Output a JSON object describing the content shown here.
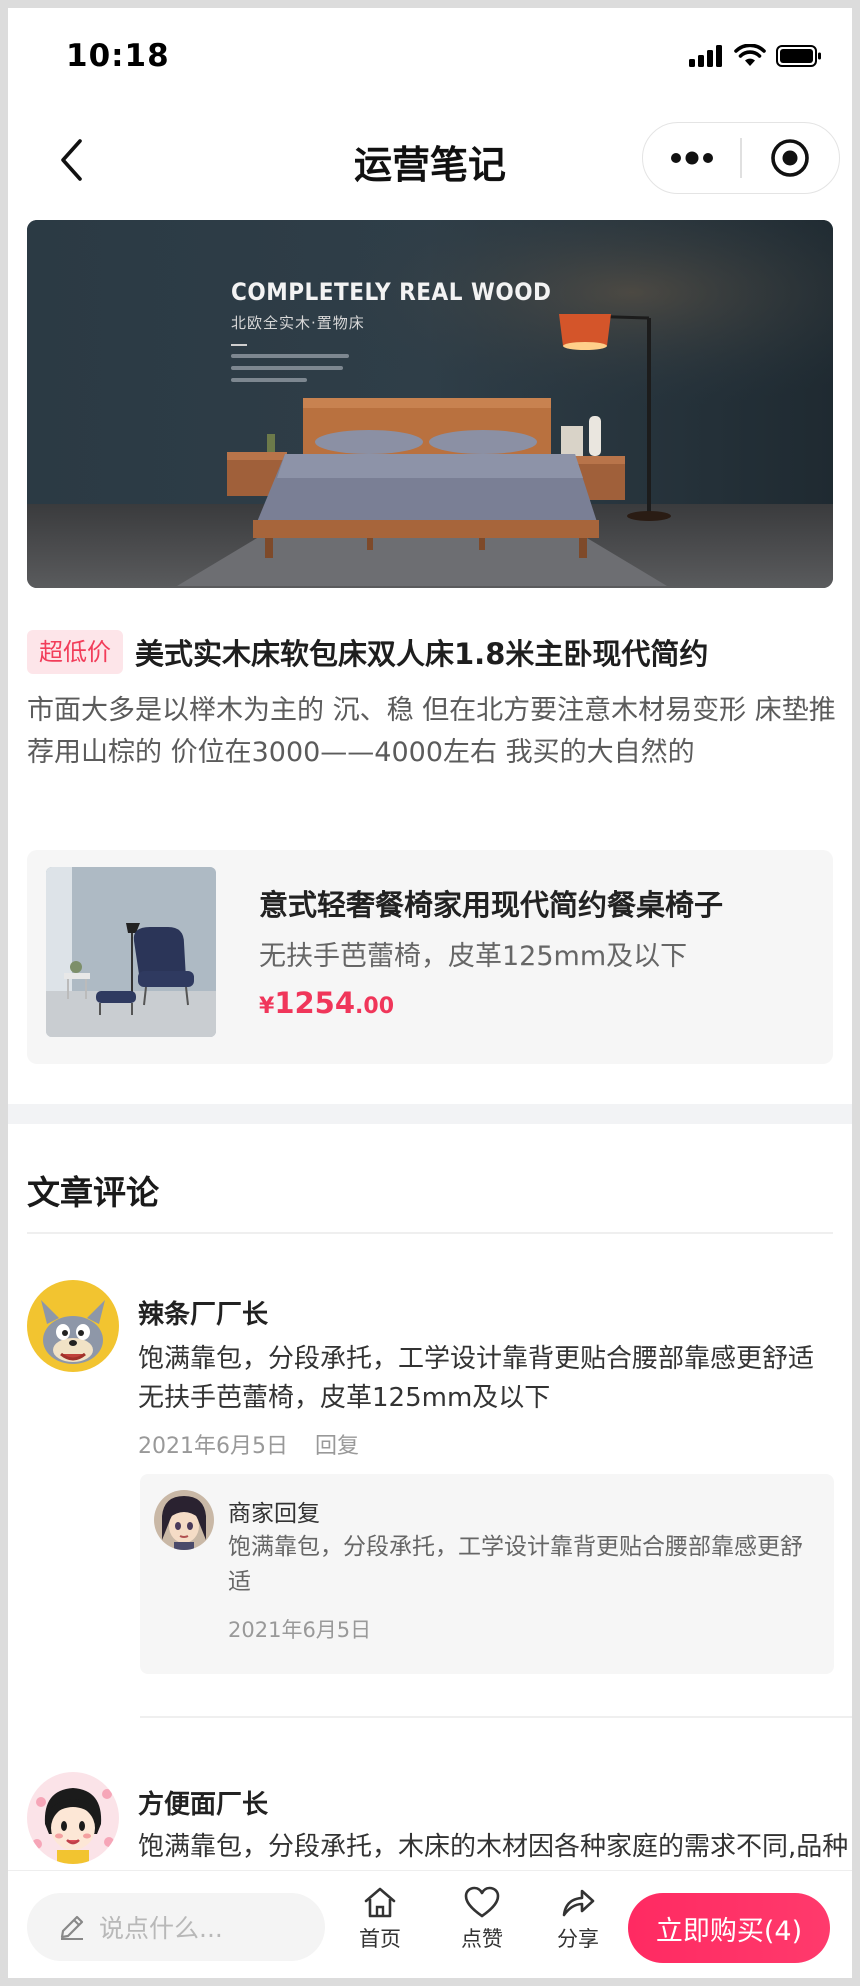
{
  "status_bar": {
    "time": "10:18"
  },
  "nav": {
    "title": "运营笔记"
  },
  "hero": {
    "title": "COMPLETELY REAL WOOD",
    "subtitle": "北欧全实木·置物床"
  },
  "product": {
    "tag": "超低价",
    "title": "美式实木床软包床双人床1.8米主卧现代简约",
    "description": "市面大多是以榉木为主的 沉、稳 但在北方要注意木材易变形 床垫推荐用山棕的 价位在3000——4000左右 我买的大自然的"
  },
  "linked_product": {
    "name": "意式轻奢餐椅家用现代简约餐桌椅子",
    "spec": "无扶手芭蕾椅，皮革125mm及以下",
    "price_symbol": "¥",
    "price_int": "1254",
    "price_dec": ".00"
  },
  "comments_section": {
    "title": "文章评论",
    "comments": [
      {
        "name": "辣条厂厂长",
        "text": "饱满靠包，分段承托，工学设计靠背更贴合腰部靠感更舒适无扶手芭蕾椅，皮革125mm及以下",
        "date": "2021年6月5日",
        "reply_label": "回复",
        "merchant_reply": {
          "name": "商家回复",
          "text": "饱满靠包，分段承托，工学设计靠背更贴合腰部靠感更舒适",
          "date": "2021年6月5日"
        }
      },
      {
        "name": "方便面厂长",
        "text": "饱满靠包，分段承托，木床的木材因各种家庭的需求不同,品种也得多样，各有各的特点在现在的家居市场有"
      }
    ]
  },
  "bottom_bar": {
    "input_placeholder": "说点什么...",
    "actions": [
      {
        "label": "首页",
        "icon": "home-icon"
      },
      {
        "label": "点赞",
        "icon": "heart-icon"
      },
      {
        "label": "分享",
        "icon": "share-icon"
      }
    ],
    "buy_label": "立即购买(4)"
  },
  "colors": {
    "accent": "#f23d5a",
    "buy_button": "#ff2a62",
    "tag_bg": "#fde5e9",
    "section_gap": "#f2f3f5"
  }
}
